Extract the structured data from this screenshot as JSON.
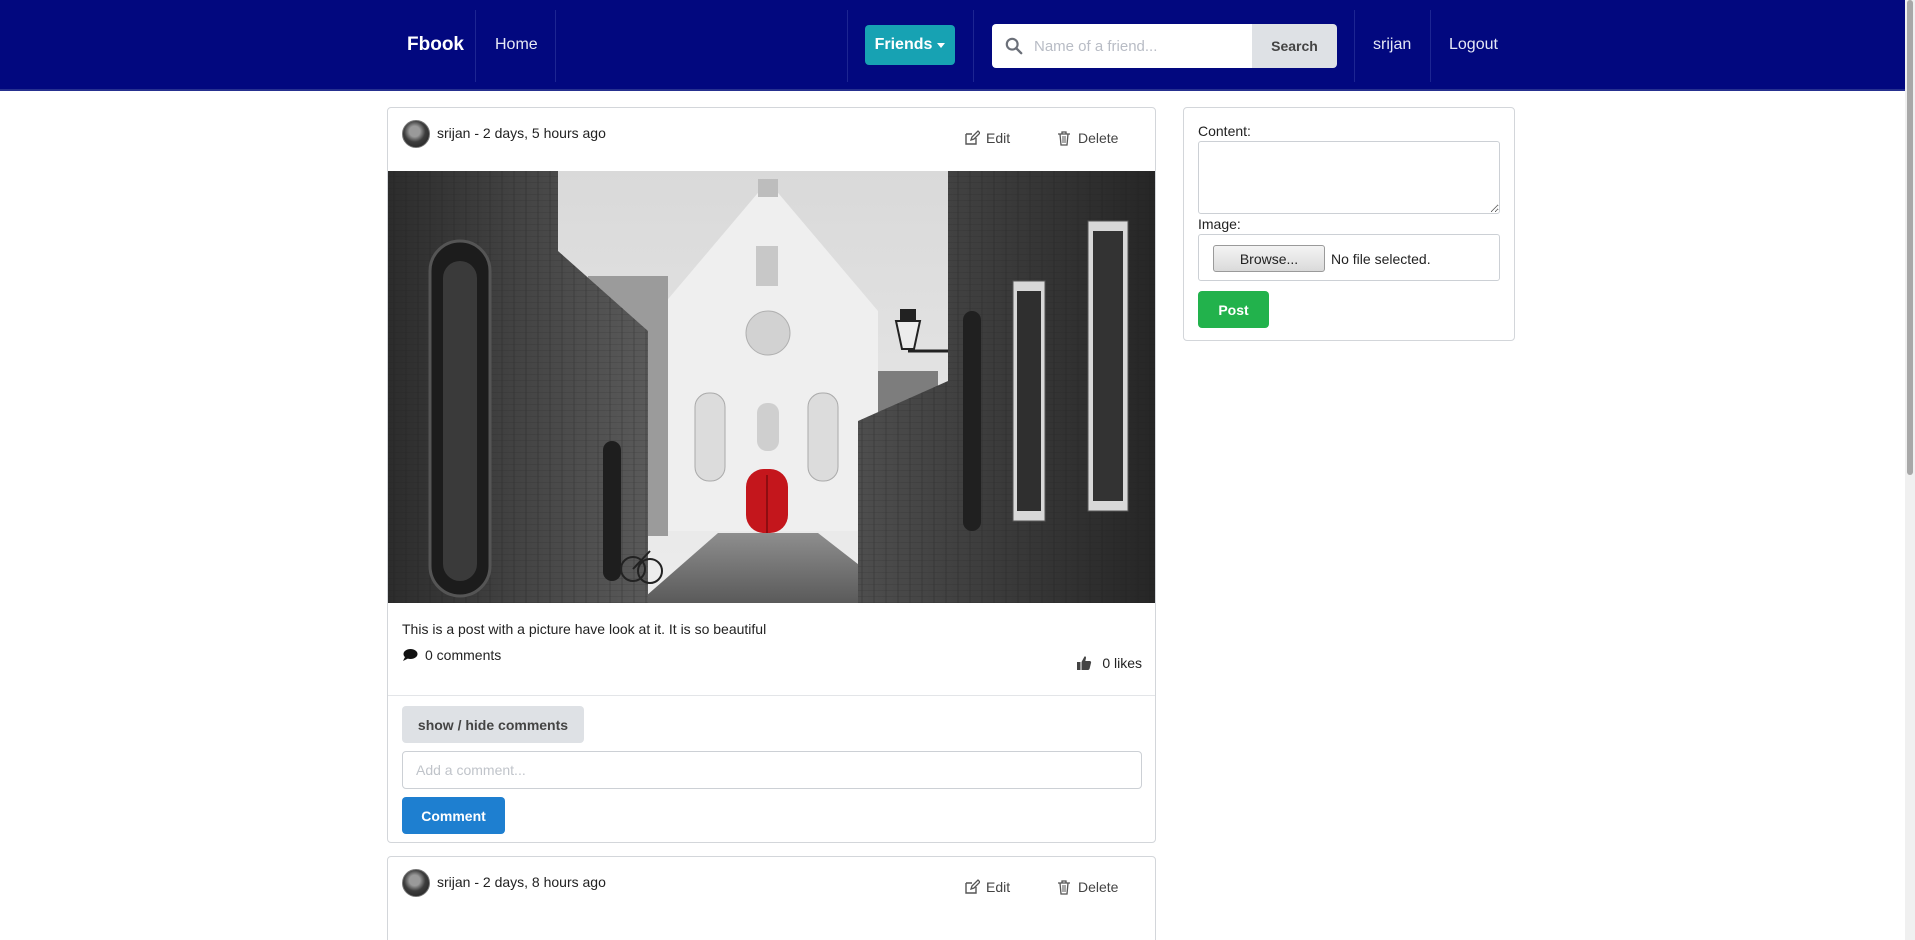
{
  "navbar": {
    "brand": "Fbook",
    "home_label": "Home",
    "friends_label": "Friends",
    "search_placeholder": "Name of a friend...",
    "search_button": "Search",
    "username": "srijan",
    "logout_label": "Logout"
  },
  "posts": [
    {
      "meta": "srijan - 2 days, 5 hours ago",
      "edit_label": "Edit",
      "delete_label": "Delete",
      "text": "This is a post with a picture have look at it. It is so beautiful",
      "comments_count": "0 comments",
      "likes_count": "0 likes",
      "toggle_comments_label": "show / hide comments",
      "comment_placeholder": "Add a comment...",
      "comment_button": "Comment"
    },
    {
      "meta": "srijan - 2 days, 8 hours ago",
      "edit_label": "Edit",
      "delete_label": "Delete"
    }
  ],
  "new_post_form": {
    "content_label": "Content:",
    "image_label": "Image:",
    "browse_label": "Browse...",
    "file_status": "No file selected.",
    "post_button": "Post"
  },
  "colors": {
    "navbar": "#02087f",
    "friends_button": "#17a2b3",
    "comment_button": "#1e7fd0",
    "post_button": "#22b24c",
    "door": "#c4161c"
  },
  "icons": [
    "search-icon",
    "edit-icon",
    "trash-icon",
    "comment-icon",
    "thumbs-up-icon",
    "caret-down-icon"
  ]
}
